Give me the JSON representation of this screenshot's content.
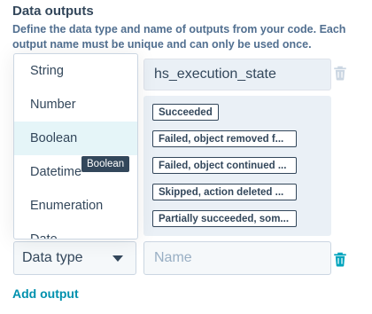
{
  "section": {
    "title": "Data outputs",
    "description": "Define the data type and name of outputs from your code. Each output name must be unique and can only be used once."
  },
  "dropdown": {
    "options": [
      "String",
      "Number",
      "Boolean",
      "Datetime",
      "Enumeration",
      "Date"
    ],
    "highlighted": "Boolean",
    "tooltip": "Boolean"
  },
  "output_1": {
    "name": "hs_execution_state",
    "options": [
      "Succeeded",
      "Failed, object removed f...",
      "Failed, object continued ...",
      "Skipped, action deleted ...",
      "Partially succeeded, som..."
    ]
  },
  "output_2": {
    "type_label": "Data type",
    "name_placeholder": "Name",
    "name_value": ""
  },
  "add_output_label": "Add output",
  "icons": {
    "delete": "trash-icon",
    "select": "caret-down-icon"
  },
  "colors": {
    "link": "#0091ae",
    "trash": "#00a4bd",
    "trash_disabled": "#cbd6e2",
    "text": "#33475b"
  }
}
